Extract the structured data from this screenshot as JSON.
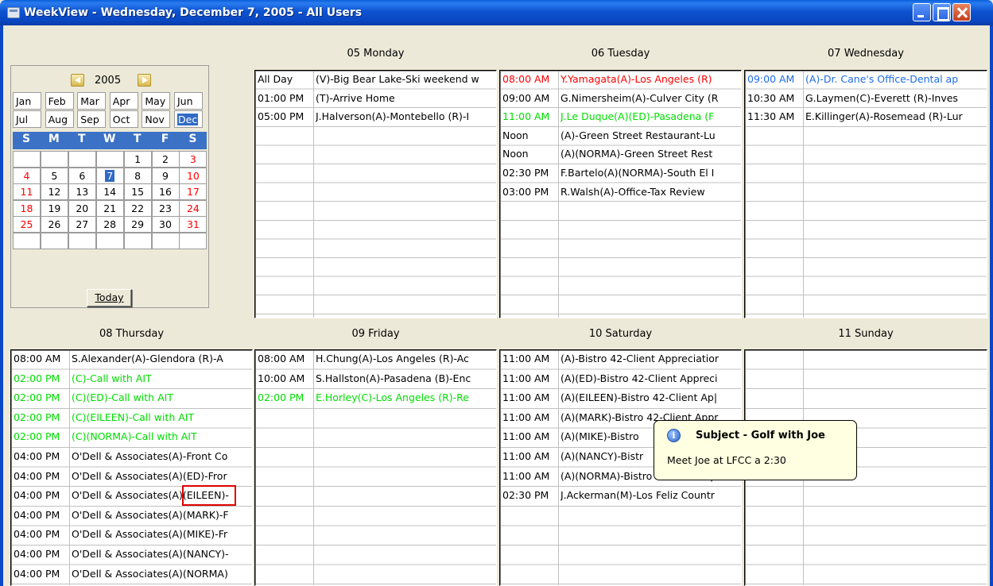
{
  "window": {
    "title": "WeekView - Wednesday, December  7, 2005  - All Users"
  },
  "calendar": {
    "year": "2005",
    "months": [
      "Jan",
      "Feb",
      "Mar",
      "Apr",
      "May",
      "Jun",
      "Jul",
      "Aug",
      "Sep",
      "Oct",
      "Nov",
      "Dec"
    ],
    "selected_month": "Dec",
    "weekdays": [
      "S",
      "M",
      "T",
      "W",
      "T",
      "F",
      "S"
    ],
    "weeks": [
      [
        "",
        "",
        "",
        "",
        "1",
        "2",
        "3"
      ],
      [
        "4",
        "5",
        "6",
        "7",
        "8",
        "9",
        "10"
      ],
      [
        "11",
        "12",
        "13",
        "14",
        "15",
        "16",
        "17"
      ],
      [
        "18",
        "19",
        "20",
        "21",
        "22",
        "23",
        "24"
      ],
      [
        "25",
        "26",
        "27",
        "28",
        "29",
        "30",
        "31"
      ],
      [
        "",
        "",
        "",
        "",
        "",
        "",
        ""
      ]
    ],
    "selected_day": "7",
    "today_button": "Today"
  },
  "days": {
    "monday": {
      "header": "05 Monday",
      "events": [
        {
          "time": "All Day",
          "subject": "(V)-Big Bear Lake-Ski weekend w",
          "color": "black"
        },
        {
          "time": "01:00 PM",
          "subject": "(T)-Arrive Home",
          "color": "black"
        },
        {
          "time": "05:00 PM",
          "subject": "J.Halverson(A)-Montebello (R)-I",
          "color": "black"
        }
      ]
    },
    "tuesday": {
      "header": "06 Tuesday",
      "events": [
        {
          "time": "08:00 AM",
          "subject": "Y.Yamagata(A)-Los Angeles (R)",
          "color": "red"
        },
        {
          "time": "09:00 AM",
          "subject": "G.Nimersheim(A)-Culver City (R",
          "color": "black"
        },
        {
          "time": "11:00 AM",
          "subject": "J.Le Duque(A)(ED)-Pasadena (F",
          "color": "green"
        },
        {
          "time": "Noon",
          "subject": "(A)-Green Street Restaurant-Lu",
          "color": "black"
        },
        {
          "time": "Noon",
          "subject": "(A)(NORMA)-Green Street Rest",
          "color": "black"
        },
        {
          "time": "02:30 PM",
          "subject": "F.Bartelo(A)(NORMA)-South El I",
          "color": "black"
        },
        {
          "time": "03:00 PM",
          "subject": "R.Walsh(A)-Office-Tax Review",
          "color": "black"
        }
      ]
    },
    "wednesday": {
      "header": "07 Wednesday",
      "events": [
        {
          "time": "09:00 AM",
          "subject": "(A)-Dr. Cane's Office-Dental ap",
          "color": "blue"
        },
        {
          "time": "10:30 AM",
          "subject": "G.Laymen(C)-Everett (R)-Inves",
          "color": "black"
        },
        {
          "time": "11:30 AM",
          "subject": "E.Killinger(A)-Rosemead (R)-Lur",
          "color": "black"
        }
      ]
    },
    "thursday": {
      "header": "08 Thursday",
      "events": [
        {
          "time": "08:00 AM",
          "subject": "S.Alexander(A)-Glendora (R)-A",
          "color": "black"
        },
        {
          "time": "02:00 PM",
          "subject": "(C)-Call with AIT",
          "color": "green"
        },
        {
          "time": "02:00 PM",
          "subject": "(C)(ED)-Call with AIT",
          "color": "green"
        },
        {
          "time": "02:00 PM",
          "subject": "(C)(EILEEN)-Call with AIT",
          "color": "green"
        },
        {
          "time": "02:00 PM",
          "subject": "(C)(NORMA)-Call with AIT",
          "color": "green"
        },
        {
          "time": "04:00 PM",
          "subject": "O'Dell & Associates(A)-Front Co",
          "color": "black"
        },
        {
          "time": "04:00 PM",
          "subject": "O'Dell & Associates(A)(ED)-Fror",
          "color": "black"
        },
        {
          "time": "04:00 PM",
          "subject": "O'Dell & Associates(A)(EILEEN)-",
          "color": "black"
        },
        {
          "time": "04:00 PM",
          "subject": "O'Dell & Associates(A)(MARK)-F",
          "color": "black"
        },
        {
          "time": "04:00 PM",
          "subject": "O'Dell & Associates(A)(MIKE)-Fr",
          "color": "black"
        },
        {
          "time": "04:00 PM",
          "subject": "O'Dell & Associates(A)(NANCY)-",
          "color": "black"
        },
        {
          "time": "04:00 PM",
          "subject": "O'Dell & Associates(A)(NORMA)",
          "color": "black"
        }
      ]
    },
    "friday": {
      "header": "09 Friday",
      "events": [
        {
          "time": "08:00 AM",
          "subject": "H.Chung(A)-Los Angeles (R)-Ac",
          "color": "black"
        },
        {
          "time": "10:00 AM",
          "subject": "S.Hallston(A)-Pasadena (B)-Enc",
          "color": "black"
        },
        {
          "time": "02:00 PM",
          "subject": "E.Horley(C)-Los Angeles (R)-Re",
          "color": "green"
        }
      ]
    },
    "saturday": {
      "header": "10 Saturday",
      "events": [
        {
          "time": "11:00 AM",
          "subject": "(A)-Bistro 42-Client Appreciatior",
          "color": "black"
        },
        {
          "time": "11:00 AM",
          "subject": "(A)(ED)-Bistro 42-Client Appreci",
          "color": "black"
        },
        {
          "time": "11:00 AM",
          "subject": "(A)(EILEEN)-Bistro 42-Client Ap|",
          "color": "black"
        },
        {
          "time": "11:00 AM",
          "subject": "(A)(MARK)-Bistro 42-Client Appr",
          "color": "black"
        },
        {
          "time": "11:00 AM",
          "subject": "(A)(MIKE)-Bistro",
          "color": "black"
        },
        {
          "time": "11:00 AM",
          "subject": "(A)(NANCY)-Bistr",
          "color": "black"
        },
        {
          "time": "11:00 AM",
          "subject": "(A)(NORMA)-Bistro 42-Client Ap",
          "color": "black"
        },
        {
          "time": "02:30 PM",
          "subject": "J.Ackerman(M)-Los Feliz Countr",
          "color": "black"
        }
      ]
    },
    "sunday": {
      "header": "11 Sunday",
      "events": []
    }
  },
  "tooltip": {
    "icon": "info-icon",
    "title": "Subject - Golf with Joe",
    "body": "Meet Joe at LFCC a 2:30"
  }
}
